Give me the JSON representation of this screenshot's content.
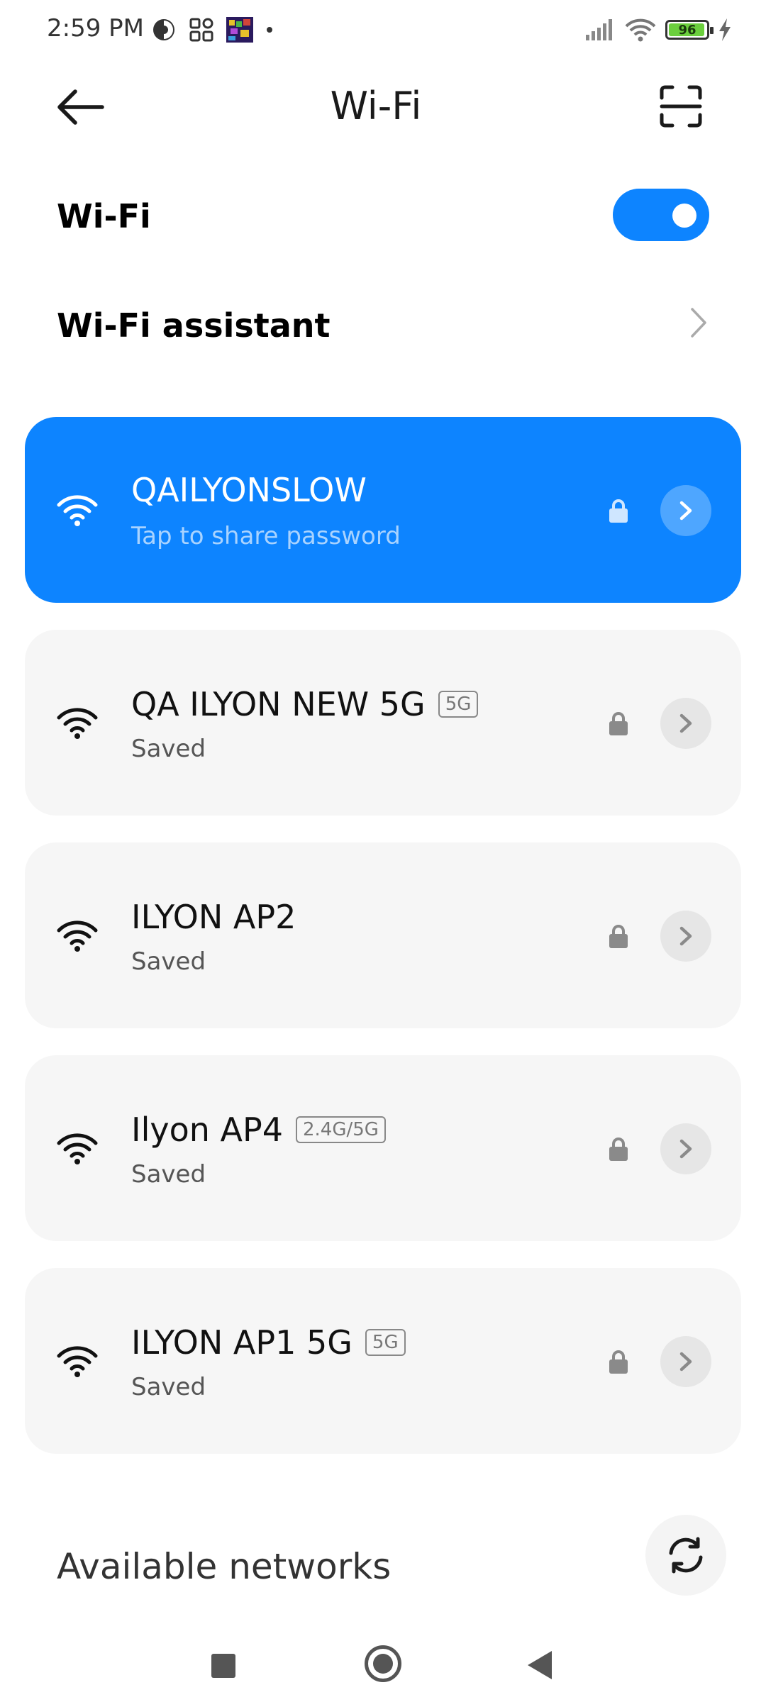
{
  "status_bar": {
    "time": "2:59 PM",
    "battery": "96",
    "battery_level": 0.96
  },
  "header": {
    "title": "Wi-Fi",
    "back_icon": "arrow-left-icon",
    "scan_icon": "qr-scan-icon"
  },
  "wifi_toggle": {
    "label": "Wi-Fi",
    "enabled": true
  },
  "wifi_assistant": {
    "label": "Wi-Fi assistant"
  },
  "networks": [
    {
      "name": "QAILYONSLOW",
      "subtitle": "Tap to share password",
      "band": "",
      "connected": true
    },
    {
      "name": "QA ILYON NEW 5G",
      "subtitle": "Saved",
      "band": "5G",
      "connected": false
    },
    {
      "name": "ILYON AP2",
      "subtitle": "Saved",
      "band": "",
      "connected": false
    },
    {
      "name": "Ilyon AP4",
      "subtitle": "Saved",
      "band": "2.4G/5G",
      "connected": false
    },
    {
      "name": "ILYON AP1 5G",
      "subtitle": "Saved",
      "band": "5G",
      "connected": false
    }
  ],
  "available_networks": {
    "title": "Available networks",
    "refresh_icon": "refresh-icon"
  },
  "colors": {
    "accent": "#0d84ff",
    "card_bg": "#f6f6f6"
  }
}
